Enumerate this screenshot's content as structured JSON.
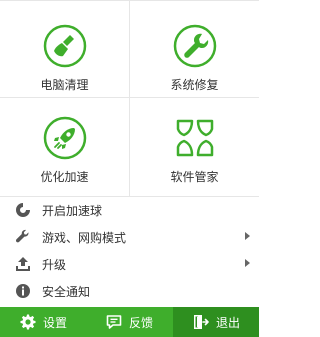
{
  "tiles": [
    {
      "label": "电脑清理",
      "icon": "broom-icon"
    },
    {
      "label": "系统修复",
      "icon": "wrench-icon"
    },
    {
      "label": "优化加速",
      "icon": "rocket-icon"
    },
    {
      "label": "软件管家",
      "icon": "petals-icon"
    }
  ],
  "menu": [
    {
      "label": "开启加速球",
      "icon": "accelerate-ball-icon",
      "submenu": false
    },
    {
      "label": "游戏、网购模式",
      "icon": "wrench-small-icon",
      "submenu": true
    },
    {
      "label": "升级",
      "icon": "upload-icon",
      "submenu": true
    },
    {
      "label": "安全通知",
      "icon": "info-icon",
      "submenu": false
    }
  ],
  "footer": {
    "settings": "设置",
    "feedback": "反馈",
    "exit": "退出"
  },
  "colors": {
    "accent": "#3fae2c",
    "accent_dark": "#2e8f1f",
    "icon_gray": "#555555"
  }
}
